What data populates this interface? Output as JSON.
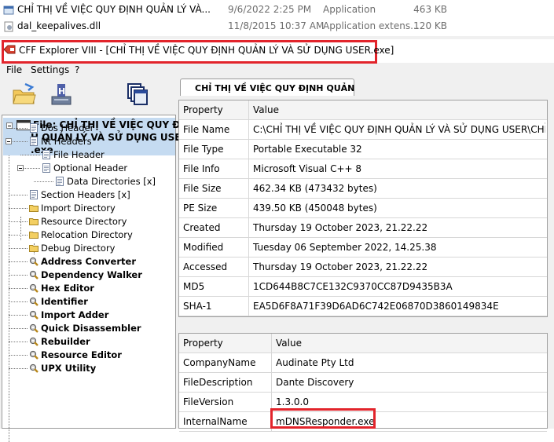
{
  "file_list": [
    {
      "name": "CHỈ THỊ VỀ VIỆC QUY ĐỊNH QUẢN LÝ VÀ...",
      "date": "9/6/2022 2:25 PM",
      "type": "Application",
      "size": "463 KB",
      "icon": "app-icon"
    },
    {
      "name": "dal_keepalives.dll",
      "date": "11/8/2015 10:37 AM",
      "type": "Application extens...",
      "size": "120 KB",
      "icon": "dll-icon"
    }
  ],
  "window": {
    "title": "CFF Explorer VIII - [CHỈ THỊ VỀ VIỆC QUY ĐỊNH QUẢN LÝ VÀ SỬ DỤNG USER.exe]",
    "highlight_color": "#e2242b"
  },
  "menu": [
    "File",
    "Settings",
    "?"
  ],
  "toolbar": [
    "open-folder-icon",
    "save-icon",
    "windows-icon"
  ],
  "tree": {
    "root_lines": [
      "File: CHỈ THỊ VỀ VIỆC QUY ĐỊN",
      "H QUẢN LÝ VÀ SỬ DỤNG USEF",
      ".exe"
    ],
    "items": [
      {
        "label": "Dos Header",
        "bold": false
      },
      {
        "label": "Nt Headers",
        "bold": false
      },
      {
        "label": "File Header",
        "bold": false
      },
      {
        "label": "Optional Header",
        "bold": false
      },
      {
        "label": "Data Directories [x]",
        "bold": false
      },
      {
        "label": "Section Headers [x]",
        "bold": false
      },
      {
        "label": "Import Directory",
        "bold": false
      },
      {
        "label": "Resource Directory",
        "bold": false
      },
      {
        "label": "Relocation Directory",
        "bold": false
      },
      {
        "label": "Debug Directory",
        "bold": false
      },
      {
        "label": "Address Converter",
        "bold": true
      },
      {
        "label": "Dependency Walker",
        "bold": true
      },
      {
        "label": "Hex Editor",
        "bold": true
      },
      {
        "label": "Identifier",
        "bold": true
      },
      {
        "label": "Import Adder",
        "bold": true
      },
      {
        "label": "Quick Disassembler",
        "bold": true
      },
      {
        "label": "Rebuilder",
        "bold": true
      },
      {
        "label": "Resource Editor",
        "bold": true
      },
      {
        "label": "UPX Utility",
        "bold": true
      }
    ]
  },
  "tab_label": "CHỈ THỊ VỀ VIỆC QUY ĐỊNH QUẢN",
  "file_props": {
    "headers": [
      "Property",
      "Value"
    ],
    "rows": [
      [
        "File Name",
        "C:\\CHỈ THỊ VỀ VIỆC QUY ĐỊNH QUẢN LÝ VÀ SỬ DỤNG USER\\CHỈ THỊ ..."
      ],
      [
        "File Type",
        "Portable Executable 32"
      ],
      [
        "File Info",
        "Microsoft Visual C++ 8"
      ],
      [
        "File Size",
        "462.34 KB (473432 bytes)"
      ],
      [
        "PE Size",
        "439.50 KB (450048 bytes)"
      ],
      [
        "Created",
        "Thursday 19 October 2023, 21.22.22"
      ],
      [
        "Modified",
        "Tuesday 06 September 2022, 14.25.38"
      ],
      [
        "Accessed",
        "Thursday 19 October 2023, 21.22.22"
      ],
      [
        "MD5",
        "1CD644B8C7CE132C9370CC87D9435B3A"
      ],
      [
        "SHA-1",
        "EA5D6F8A71F39D6AD6C742E06870D3860149834E"
      ]
    ]
  },
  "version_props": {
    "headers": [
      "Property",
      "Value"
    ],
    "rows": [
      [
        "CompanyName",
        "Audinate Pty Ltd"
      ],
      [
        "FileDescription",
        "Dante Discovery"
      ],
      [
        "FileVersion",
        "1.3.0.0"
      ],
      [
        "InternalName",
        "mDNSResponder.exe"
      ]
    ]
  }
}
